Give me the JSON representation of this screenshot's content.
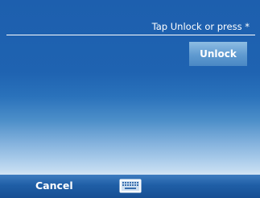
{
  "lock_screen": {
    "hint_text": "Tap Unlock or press *",
    "unlock_label": "Unlock"
  },
  "softkeys": {
    "left_label": "Cancel",
    "center_icon": "keyboard-icon"
  },
  "colors": {
    "background_top": "#1d5fae",
    "background_bottom": "#cfe2f4",
    "button": "#5f9ad0",
    "softkey_bar": "#1f5ea6",
    "text": "#ffffff"
  }
}
